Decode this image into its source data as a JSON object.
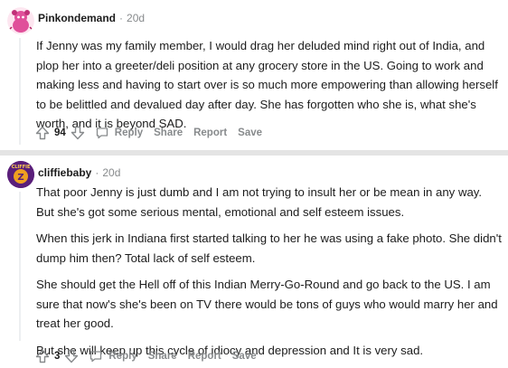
{
  "comments": [
    {
      "username": "Pinkondemand",
      "age": "20d",
      "paragraphs": [
        "If Jenny was my family member, I would drag her deluded mind right out of India, and plop her into a greeter/deli position at any grocery store in the US. Going to work and making less and having to start over is so much more empowering than allowing herself to be belittled and devalued day after day. She has forgotten who she is, what she's worth, and it is beyond SAD."
      ],
      "score": "94",
      "actions": {
        "reply": "Reply",
        "share": "Share",
        "report": "Report",
        "save": "Save"
      },
      "avatar_icon": "pink-snoo-avatar"
    },
    {
      "username": "cliffiebaby",
      "age": "20d",
      "paragraphs": [
        "That poor Jenny is just dumb and I am not trying to insult her or be mean in any way. But she's got some serious mental, emotional and self esteem issues.",
        "When this jerk in Indiana first started talking to her he was using a fake photo. She didn't dump him then? Total lack of self esteem.",
        "She should get the Hell off of this Indian Merry-Go-Round and go back to the US. I am sure that now's she's been on TV there would be tons of guys who would marry her and treat her good.",
        "But she will keep up this cycle of idiocy and depression and It is very sad."
      ],
      "score": "3",
      "actions": {
        "reply": "Reply",
        "share": "Share",
        "report": "Report",
        "save": "Save"
      },
      "avatar_icon": "cliffie-z-avatar",
      "avatar_text": "CLIFFIE"
    }
  ],
  "colors": {
    "meta_gray": "#878a8c",
    "text": "#1c1c1c",
    "divider": "#e4e4e4",
    "pink_avatar": "#e0509a",
    "purple_avatar": "#5a1f7a",
    "orange_z": "#f0a020"
  }
}
